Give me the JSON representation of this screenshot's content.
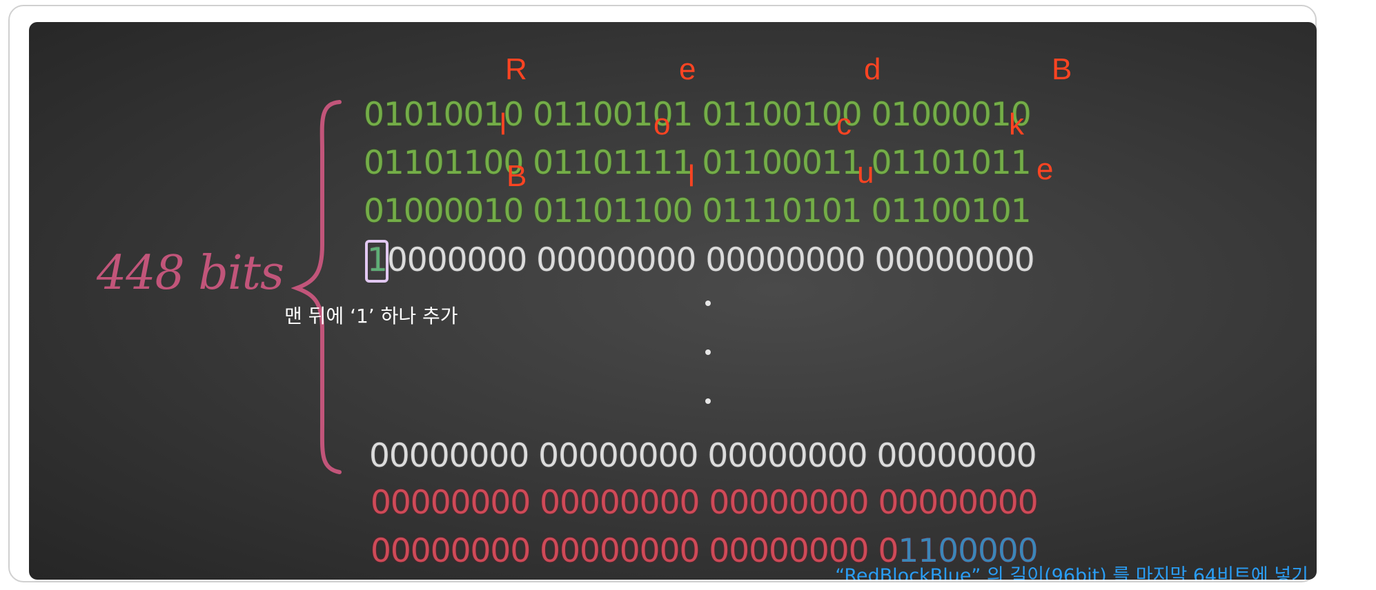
{
  "diagram": {
    "side_label": "448 bits",
    "rows": [
      {
        "kind": "green",
        "text": "01010010 01100101 01100100 01000010"
      },
      {
        "kind": "green",
        "text": "01101100 01101111 01100011 01101011"
      },
      {
        "kind": "green",
        "text": "01000010 01101100 01110101 01100101"
      },
      {
        "kind": "white",
        "first": "1",
        "text": "0000000 00000000 00000000 00000000"
      },
      {
        "kind": "white",
        "text": "00000000 00000000 00000000 00000000"
      },
      {
        "kind": "red",
        "text": "00000000 00000000 00000000 00000000"
      },
      {
        "kind": "red",
        "text": "00000000 00000000 00000000 0",
        "tail": "1100000"
      }
    ],
    "letters": [
      "R",
      "e",
      "d",
      "B",
      "l",
      "o",
      "c",
      "k",
      "B",
      "l",
      "u",
      "e"
    ],
    "ellipsis": [
      ".",
      ".",
      "."
    ],
    "note_left": "맨 뒤에 ‘1’ 하나 추가",
    "note_bottom": "“RedBlockBlue” 의 길이(96bit) 를 마지막 64비트에 넣기",
    "colors": {
      "green_bits": "#74ad48",
      "white_bits": "#dcdcdc",
      "red_bits": "#cf4a58",
      "length_bits": "#3c86b8",
      "letters": "#ff4422",
      "brace": "#c2557a",
      "highlight": "#e2c8f2",
      "note_bottom": "#2a9df4"
    }
  }
}
